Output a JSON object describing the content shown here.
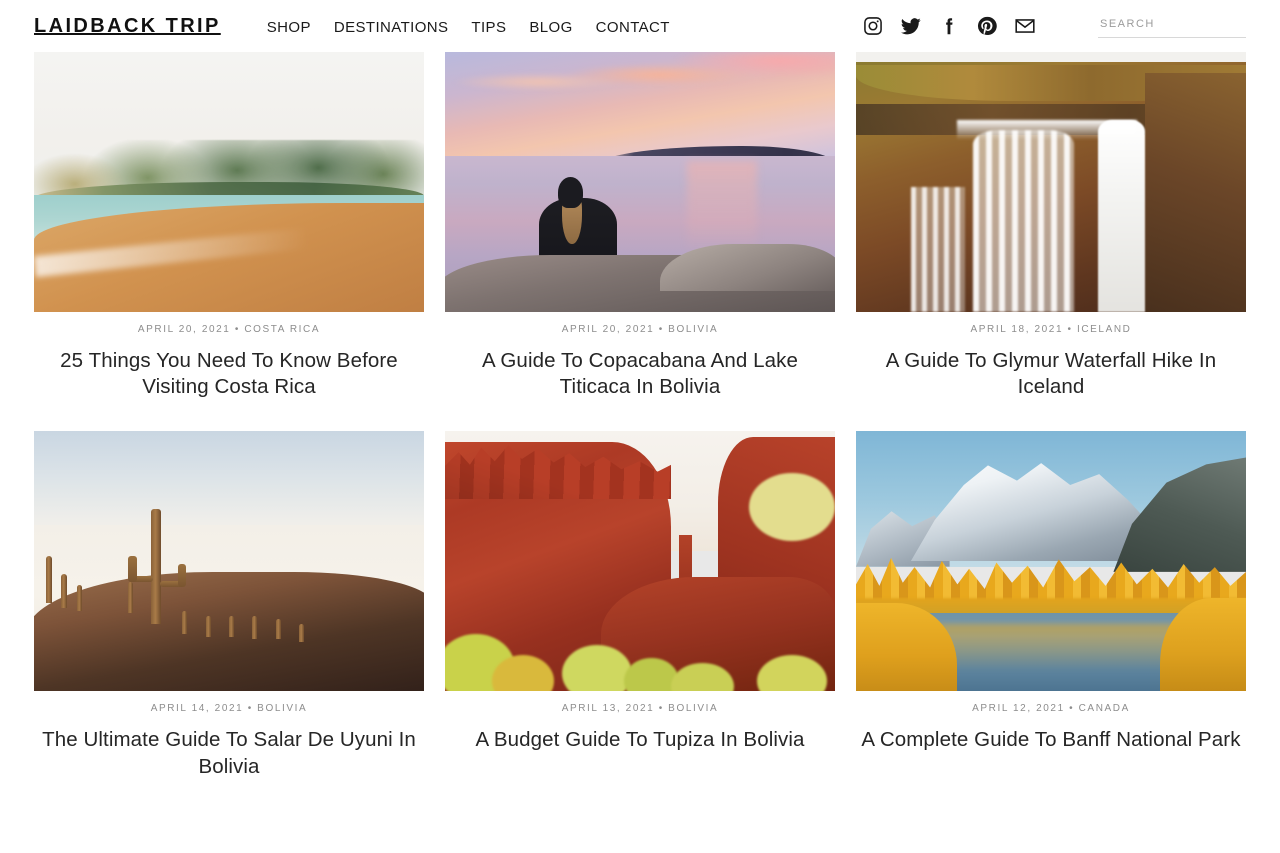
{
  "header": {
    "logo": "LAIDBACK TRIP",
    "nav": [
      {
        "label": "SHOP"
      },
      {
        "label": "DESTINATIONS"
      },
      {
        "label": "TIPS"
      },
      {
        "label": "BLOG"
      },
      {
        "label": "CONTACT"
      }
    ],
    "social": [
      {
        "name": "instagram-icon",
        "label": "Instagram"
      },
      {
        "name": "twitter-icon",
        "label": "Twitter"
      },
      {
        "name": "facebook-icon",
        "label": "Facebook"
      },
      {
        "name": "pinterest-icon",
        "label": "Pinterest"
      },
      {
        "name": "email-icon",
        "label": "Email"
      }
    ],
    "search": {
      "placeholder": "SEARCH",
      "value": ""
    }
  },
  "posts": [
    {
      "date": "APRIL 20, 2021",
      "separator": "•",
      "category": "COSTA RICA",
      "meta": "APRIL 20, 2021 • COSTA RICA",
      "title": "25 Things You Need To Know Before Visiting Costa Rica",
      "image_alt": "Tropical beach with orange sand, turquoise water and a green forested headland"
    },
    {
      "date": "APRIL 20, 2021",
      "separator": "•",
      "category": "BOLIVIA",
      "meta": "APRIL 20, 2021 • BOLIVIA",
      "title": "A Guide To Copacabana And Lake Titicaca In Bolivia",
      "image_alt": "Woman in a black jacket sitting on a stone wall facing a pink sunset over a lake"
    },
    {
      "date": "APRIL 18, 2021",
      "separator": "•",
      "category": "ICELAND",
      "meta": "APRIL 18, 2021 • ICELAND",
      "title": "A Guide To Glymur Waterfall Hike In Iceland",
      "image_alt": "Wide waterfall cascading down golden and rust coloured cliffs"
    },
    {
      "date": "APRIL 14, 2021",
      "separator": "•",
      "category": "BOLIVIA",
      "meta": "APRIL 14, 2021 • BOLIVIA",
      "title": "The Ultimate Guide To Salar De Uyuni In Bolivia",
      "image_alt": "Tall cacti on a rocky ridge overlooking a bright white salt flat"
    },
    {
      "date": "APRIL 13, 2021",
      "separator": "•",
      "category": "BOLIVIA",
      "meta": "APRIL 13, 2021 • BOLIVIA",
      "title": "A Budget Guide To Tupiza In Bolivia",
      "image_alt": "Red rock canyon formations with yellow green shrubs"
    },
    {
      "date": "APRIL 12, 2021",
      "separator": "•",
      "category": "CANADA",
      "meta": "APRIL 12, 2021 • CANADA",
      "title": "A Complete Guide To Banff National Park",
      "image_alt": "Snow capped mountain above golden larch forest reflected in a calm lake"
    }
  ],
  "colors": {
    "text": "#262626",
    "meta": "#8d8d8d",
    "background": "#ffffff",
    "rule": "#d8d8d8"
  }
}
